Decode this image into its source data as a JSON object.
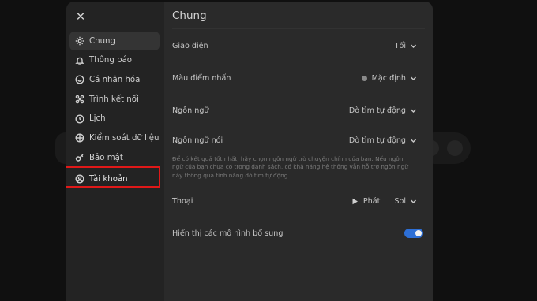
{
  "sidebar": {
    "items": [
      {
        "label": "Chung",
        "icon": "gear-icon",
        "active": true
      },
      {
        "label": "Thông báo",
        "icon": "bell-icon"
      },
      {
        "label": "Cá nhân hóa",
        "icon": "personalize-icon"
      },
      {
        "label": "Trình kết nối",
        "icon": "connector-icon"
      },
      {
        "label": "Lịch",
        "icon": "schedule-icon"
      },
      {
        "label": "Kiểm soát dữ liệu",
        "icon": "data-control-icon"
      },
      {
        "label": "Bảo mật",
        "icon": "security-icon"
      },
      {
        "label": "Tài khoản",
        "icon": "account-icon",
        "highlighted": true
      }
    ]
  },
  "content": {
    "title": "Chung",
    "appearance": {
      "label": "Giao diện",
      "value": "Tối"
    },
    "accent": {
      "label": "Màu điểm nhấn",
      "value": "Mặc định",
      "color": "#8a8a8a"
    },
    "language": {
      "label": "Ngôn ngữ",
      "value": "Dò tìm tự động"
    },
    "spoken_language": {
      "label": "Ngôn ngữ nói",
      "value": "Dò tìm tự động",
      "hint": "Để có kết quả tốt nhất, hãy chọn ngôn ngữ trò chuyện chính của bạn. Nếu ngôn ngữ của bạn chưa có trong danh sách, có khả năng hệ thống vẫn hỗ trợ ngôn ngữ này thông qua tính năng dò tìm tự động."
    },
    "voice": {
      "label": "Thoại",
      "play_label": "Phát",
      "value": "Sol"
    },
    "extra_models": {
      "label": "Hiển thị các mô hình bổ sung",
      "enabled": true
    }
  },
  "colors": {
    "toggle_on": "#2d6fd6",
    "highlight_box": "#e01818"
  }
}
